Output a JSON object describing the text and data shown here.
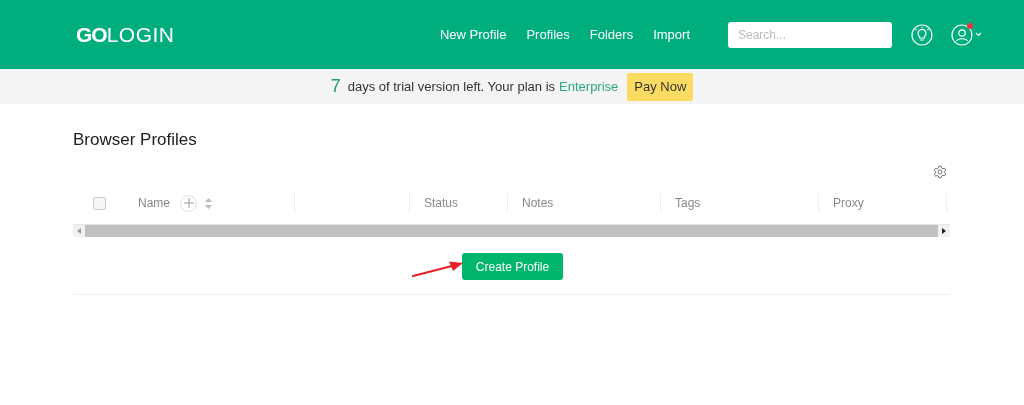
{
  "header": {
    "logo": "**GO**LOGIN",
    "nav": [
      {
        "label": "New Profile"
      },
      {
        "label": "Profiles"
      },
      {
        "label": "Folders"
      },
      {
        "label": "Import"
      }
    ],
    "search": {
      "placeholder": "Search..."
    },
    "notification_dot": true
  },
  "banner": {
    "days": "7",
    "text": "days of trial version left. Your plan is",
    "plan": "Enterprise",
    "button": "Pay Now"
  },
  "page": {
    "title": "Browser Profiles"
  },
  "table": {
    "select_all_checked": false,
    "columns": [
      {
        "kind": "name",
        "label": "Name"
      },
      {
        "kind": "blank"
      },
      {
        "kind": "text",
        "label": "Status"
      },
      {
        "kind": "text",
        "label": "Notes"
      },
      {
        "kind": "text",
        "label": "Tags"
      },
      {
        "kind": "text",
        "label": "Proxy"
      }
    ]
  },
  "create_button": "Create Profile"
}
